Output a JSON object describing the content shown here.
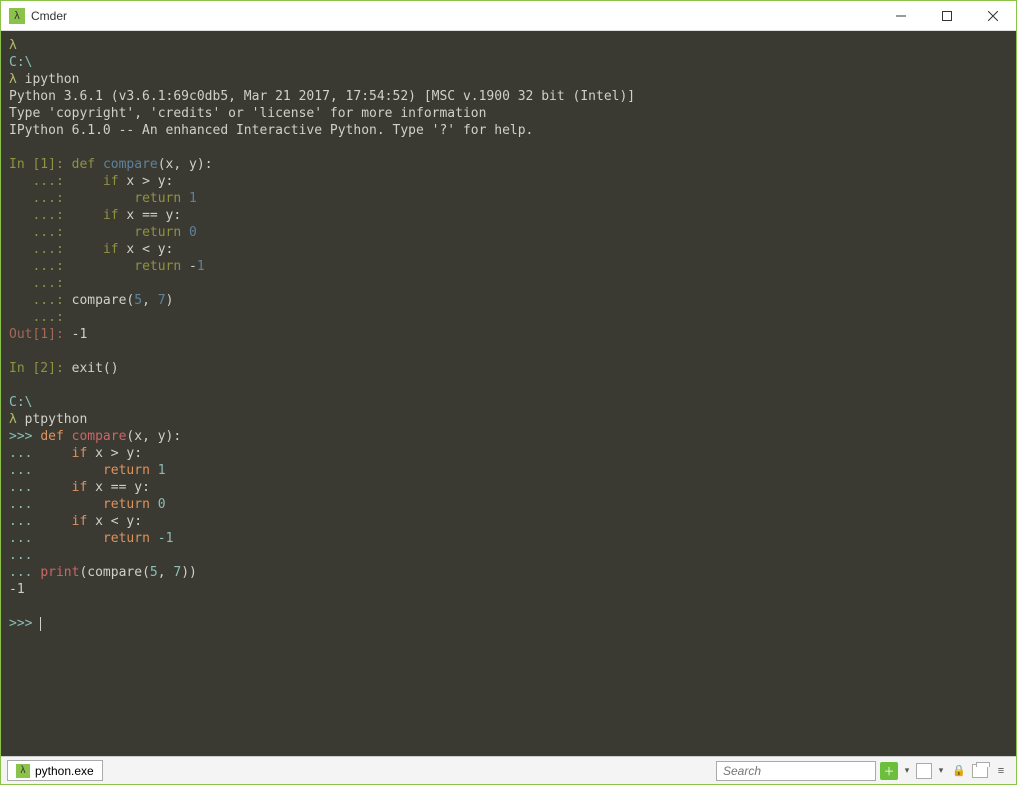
{
  "window": {
    "title": "Cmder"
  },
  "terminal": {
    "l01_lambda": "λ",
    "l02_path": "C:\\",
    "l03_lambda": "λ ",
    "l03_cmd": "ipython",
    "l04": "Python 3.6.1 (v3.6.1:69c0db5, Mar 21 2017, 17:54:52) [MSC v.1900 32 bit (Intel)]",
    "l05": "Type 'copyright', 'credits' or 'license' for more information",
    "l06": "IPython 6.1.0 -- An enhanced Interactive Python. Type '?' for help.",
    "blank": "",
    "in1_label": "In [1]: ",
    "in1_def": "def ",
    "in1_fn": "compare",
    "in1_args": "(x, y):",
    "cont": "   ...: ",
    "body1_a": "    ",
    "body1_b": "if ",
    "body1_c": "x > y:",
    "body2_a": "        ",
    "body2_b": "return ",
    "body2_c": "1",
    "body3_a": "    ",
    "body3_b": "if ",
    "body3_c": "x == y:",
    "body4_a": "        ",
    "body4_b": "return ",
    "body4_c": "0",
    "body5_a": "    ",
    "body5_b": "if ",
    "body5_c": "x < y:",
    "body6_a": "        ",
    "body6_b": "return ",
    "body6_c": "-",
    "body6_d": "1",
    "call_a": "compare(",
    "call_b": "5",
    "call_c": ", ",
    "call_d": "7",
    "call_e": ")",
    "out1_label": "Out[1]: ",
    "out1_val": "-1",
    "in2_label": "In [2]: ",
    "in2_cmd": "exit()",
    "path2": "C:\\",
    "cmd2_lambda": "λ ",
    "cmd2": "ptpython",
    "pp_prompt": ">>> ",
    "pp_cont": "... ",
    "pp_def": "def ",
    "pp_fn": "compare",
    "pp_args": "(x, y):",
    "pp_b1a": "    ",
    "pp_b1b": "if ",
    "pp_b1c": "x > y:",
    "pp_b2a": "        ",
    "pp_b2b": "return ",
    "pp_b2c": "1",
    "pp_b3a": "    ",
    "pp_b3b": "if ",
    "pp_b3c": "x == y:",
    "pp_b4a": "        ",
    "pp_b4b": "return ",
    "pp_b4c": "0",
    "pp_b5a": "    ",
    "pp_b5b": "if ",
    "pp_b5c": "x < y:",
    "pp_b6a": "        ",
    "pp_b6b": "return ",
    "pp_b6c": "-",
    "pp_b6d": "1",
    "pp_print": "print",
    "pp_call_a": "(compare(",
    "pp_call_b": "5",
    "pp_call_c": ", ",
    "pp_call_d": "7",
    "pp_call_e": "))",
    "pp_result": "-1"
  },
  "statusbar": {
    "tab_label": "python.exe",
    "search_placeholder": "Search"
  }
}
